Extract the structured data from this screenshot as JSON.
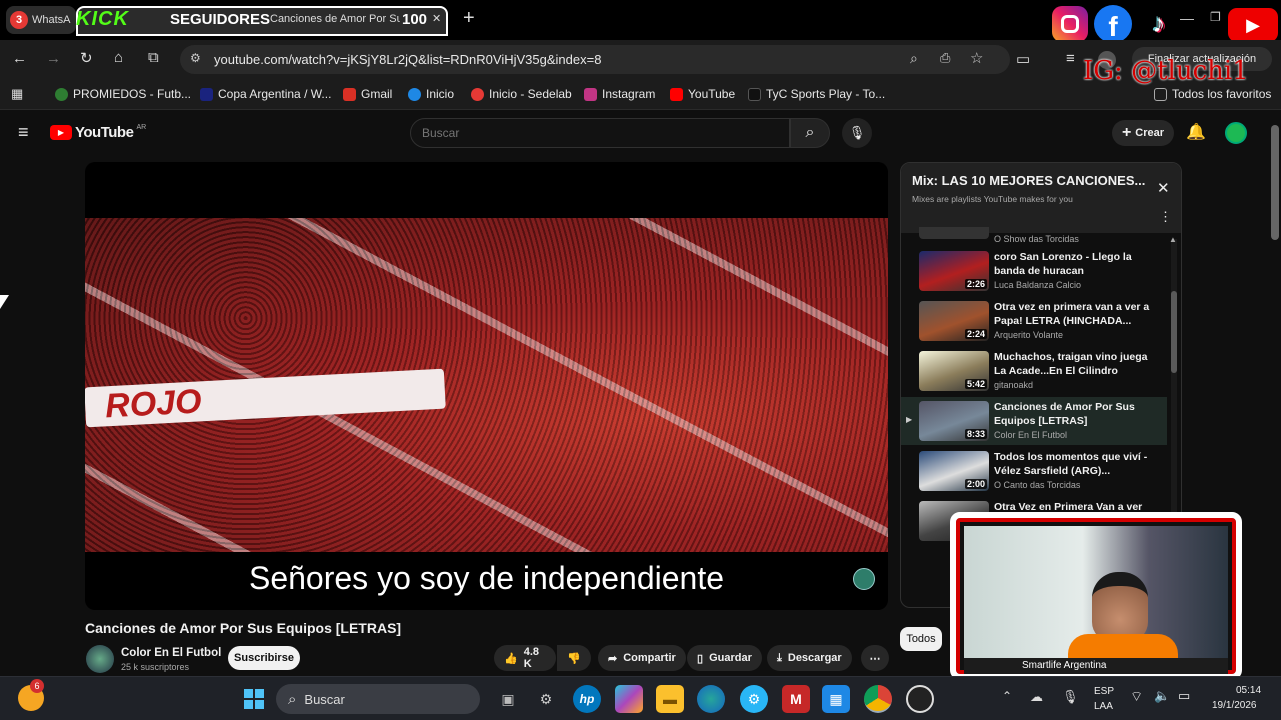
{
  "browser": {
    "tabs": [
      {
        "label": "WhatsA",
        "badge": "3"
      },
      {
        "label": "Canciones de Amor Por Sus"
      }
    ],
    "overlay_kick": "KICK",
    "overlay_followers_label": "SEGUIDORES",
    "overlay_followers_count": "100",
    "new_tab": "+",
    "url": "youtube.com/watch?v=jKSjY8Lr2jQ&list=RDnR0ViHjV35g&index=8",
    "update_button": "Finalizar actualización",
    "all_bookmarks": "Todos los favoritos",
    "bookmarks": [
      {
        "label": "PROMIEDOS - Futb...",
        "color": "#2e7d32"
      },
      {
        "label": "Copa Argentina / W...",
        "color": "#1a237e"
      },
      {
        "label": "Gmail",
        "color": "#d93025"
      },
      {
        "label": "Inicio",
        "color": "#1e88e5"
      },
      {
        "label": "Inicio - Sedelab",
        "color": "#e53935"
      },
      {
        "label": "Instagram",
        "color": "#c13584"
      },
      {
        "label": "YouTube",
        "color": "#ff0000"
      },
      {
        "label": "TyC Sports Play - To...",
        "color": "#111111"
      }
    ]
  },
  "overlay": {
    "ig_handle": "IG: @tluchi1"
  },
  "youtube": {
    "logo": "YouTube",
    "country": "AR",
    "search_placeholder": "Buscar",
    "create": "Crear",
    "subtitle": "Señores yo soy de independiente",
    "video_title": "Canciones de Amor Por Sus Equipos [LETRAS]",
    "channel": "Color En El Futbol",
    "subscribers": "25 k suscriptores",
    "subscribe": "Suscribirse",
    "likes": "4.8 K",
    "share": "Compartir",
    "save": "Guardar",
    "download": "Descargar",
    "chip_all": "Todos",
    "playlist": {
      "title": "Mix: LAS 10 MEJORES CANCIONES...",
      "subtitle": "Mixes are playlists YouTube makes for you",
      "top_channel": "O Show das Torcidas",
      "items": [
        {
          "title": "coro San Lorenzo - Llego la banda de huracan",
          "channel": "Luca Baldanza Calcio",
          "duration": "2:26"
        },
        {
          "title": "Otra vez en primera van a ver a Papa! LETRA (HINCHADA...",
          "channel": "Arquerito Volante",
          "duration": "2:24"
        },
        {
          "title": "Muchachos, traigan vino juega La Acade...En El Cilindro",
          "channel": "gitanoakd",
          "duration": "5:42"
        },
        {
          "title": "Canciones de Amor Por Sus Equipos [LETRAS]",
          "channel": "Color En El Futbol",
          "duration": "8:33"
        },
        {
          "title": "Todos los momentos que viví - Vélez Sarsfield (ARG)...",
          "channel": "O Canto das Torcidas",
          "duration": "2:00"
        },
        {
          "title": "Otra Vez en Primera Van a ver",
          "channel": "",
          "duration": ""
        }
      ]
    }
  },
  "webcam": {
    "label": "Smartlife Argentina"
  },
  "taskbar": {
    "weather_badge": "6",
    "search": "Buscar",
    "lang_top": "ESP",
    "lang_bottom": "LAA",
    "time": "05:14",
    "date": "19/1/2026"
  }
}
